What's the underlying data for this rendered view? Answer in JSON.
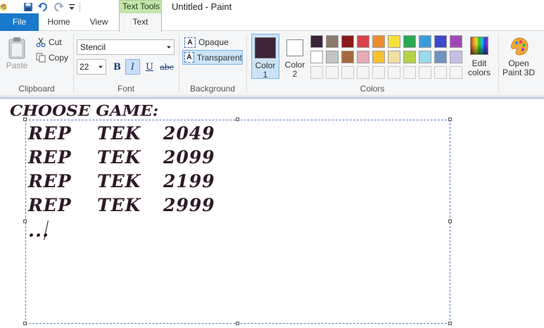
{
  "titlebar": {
    "window_title": "Untitled - Paint",
    "context_tab_group": "Text Tools",
    "quick_access": [
      "save-icon",
      "undo-icon",
      "redo-icon",
      "customize-quick-access-icon"
    ]
  },
  "tabs": [
    {
      "label": "File",
      "active": false
    },
    {
      "label": "Home",
      "active": false
    },
    {
      "label": "View",
      "active": false
    },
    {
      "label": "Text",
      "active": true
    }
  ],
  "ribbon": {
    "clipboard": {
      "label": "Clipboard",
      "paste": "Paste",
      "cut": "Cut",
      "copy": "Copy"
    },
    "font": {
      "label": "Font",
      "family": "Stencil",
      "size": "22",
      "bold": "B",
      "italic": "I",
      "italic_active": true,
      "underline": "U",
      "strikethrough": "abc"
    },
    "background": {
      "label": "Background",
      "opaque": "Opaque",
      "transparent": "Transparent",
      "selected": "Transparent"
    },
    "colors": {
      "label": "Colors",
      "color1_label": "Color 1",
      "color1_value": "#3d2438",
      "color2_label": "Color 2",
      "color2_value": "#ffffff",
      "palette": [
        [
          "#3d2438",
          "#8b7b6b",
          "#8b1a1a",
          "#d9434a",
          "#ee8c2b",
          "#f5e13a",
          "#2aa852",
          "#3a9cdc",
          "#3f48cc",
          "#a049b6"
        ],
        [
          "#ffffff",
          "#c3c3c3",
          "#a56a3b",
          "#e6aab6",
          "#f7c12f",
          "#f2dfa3",
          "#b5d34a",
          "#99d9ea",
          "#7092be",
          "#c8bfe7"
        ],
        [
          "#f5f5f5",
          "#f5f5f5",
          "#f5f5f5",
          "#f5f5f5",
          "#f5f5f5",
          "#f5f5f5",
          "#f5f5f5",
          "#f5f5f5",
          "#f5f5f5",
          "#f5f5f5"
        ]
      ],
      "edit_colors": "Edit colors",
      "open_paint3d": "Open Paint 3D"
    }
  },
  "canvas": {
    "heading": "CHOOSE GAME:",
    "rows": [
      [
        "REP",
        "TEK",
        "2049"
      ],
      [
        "REP",
        "TEK",
        "2099"
      ],
      [
        "REP",
        "TEK",
        "2199"
      ],
      [
        "REP",
        "TEK",
        "2999"
      ]
    ],
    "last_line": "...",
    "text_color": "#2e1a27"
  }
}
